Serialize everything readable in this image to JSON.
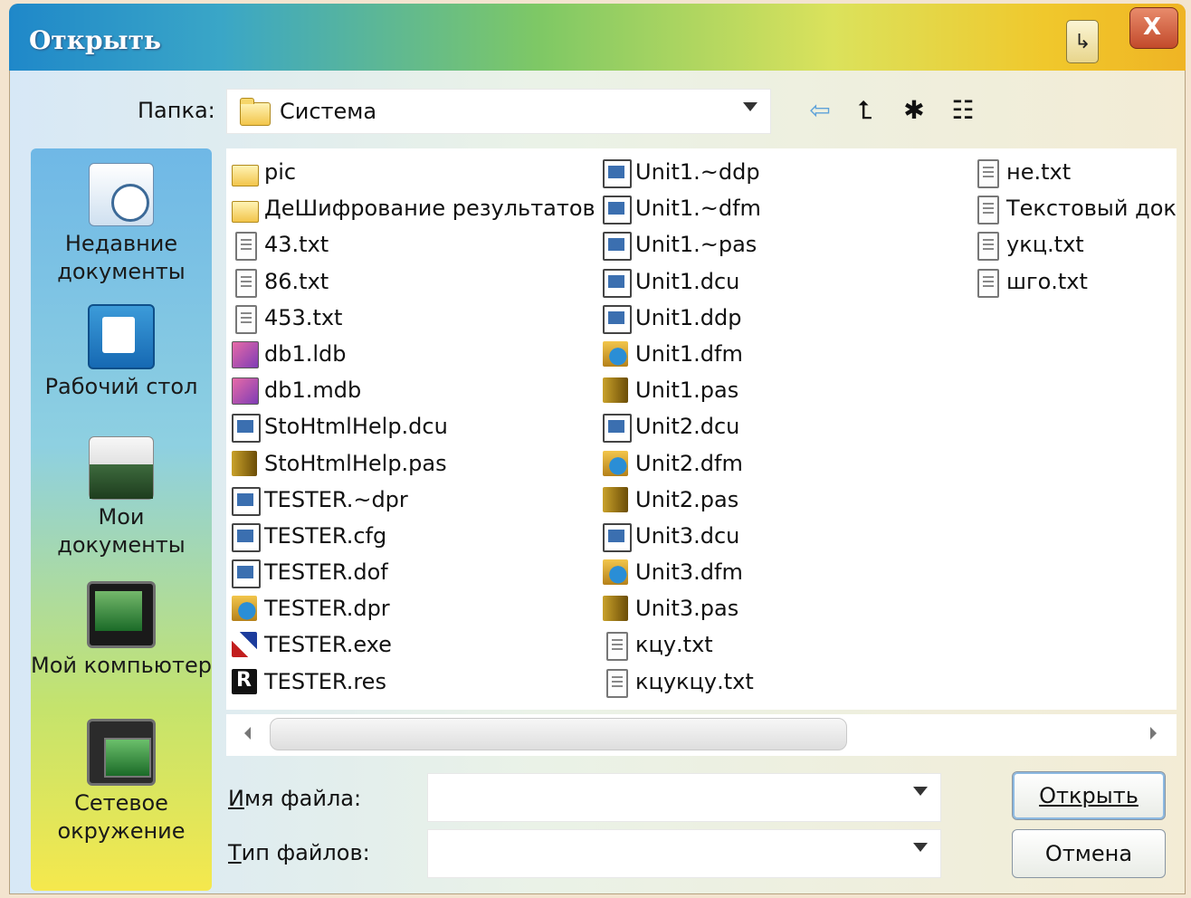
{
  "window": {
    "title": "Открыть"
  },
  "titlebar": {
    "close_label": "X"
  },
  "folder": {
    "label": "Папка:",
    "current": "Система"
  },
  "places": [
    {
      "label": "Недавние документы",
      "icon": "recent-documents-icon"
    },
    {
      "label": "Рабочий стол",
      "icon": "desktop-icon"
    },
    {
      "label": "Мои документы",
      "icon": "my-documents-icon"
    },
    {
      "label": "Мой компьютер",
      "icon": "my-computer-icon"
    },
    {
      "label": "Сетевое окружение",
      "icon": "network-icon"
    }
  ],
  "files": {
    "col1": [
      {
        "name": "pic",
        "icon": "folder-icon"
      },
      {
        "name": "ДеШифрование результатов",
        "icon": "folder-icon"
      },
      {
        "name": "43.txt",
        "icon": "text-file-icon"
      },
      {
        "name": "86.txt",
        "icon": "text-file-icon"
      },
      {
        "name": "453.txt",
        "icon": "text-file-icon"
      },
      {
        "name": "db1.ldb",
        "icon": "database-file-icon"
      },
      {
        "name": "db1.mdb",
        "icon": "database-file-icon"
      },
      {
        "name": "StoHtmlHelp.dcu",
        "icon": "delphi-unit-icon"
      },
      {
        "name": "StoHtmlHelp.pas",
        "icon": "pascal-source-icon"
      },
      {
        "name": "TESTER.~dpr",
        "icon": "delphi-unit-icon"
      },
      {
        "name": "TESTER.cfg",
        "icon": "delphi-unit-icon"
      },
      {
        "name": "TESTER.dof",
        "icon": "delphi-unit-icon"
      },
      {
        "name": "TESTER.dpr",
        "icon": "delphi-project-icon"
      },
      {
        "name": "TESTER.exe",
        "icon": "exe-icon"
      },
      {
        "name": "TESTER.res",
        "icon": "resource-file-icon"
      }
    ],
    "col2": [
      {
        "name": "Unit1.~ddp",
        "icon": "delphi-unit-icon"
      },
      {
        "name": "Unit1.~dfm",
        "icon": "delphi-unit-icon"
      },
      {
        "name": "Unit1.~pas",
        "icon": "delphi-unit-icon"
      },
      {
        "name": "Unit1.dcu",
        "icon": "delphi-unit-icon"
      },
      {
        "name": "Unit1.ddp",
        "icon": "delphi-unit-icon"
      },
      {
        "name": "Unit1.dfm",
        "icon": "delphi-project-icon"
      },
      {
        "name": "Unit1.pas",
        "icon": "pascal-source-icon"
      },
      {
        "name": "Unit2.dcu",
        "icon": "delphi-unit-icon"
      },
      {
        "name": "Unit2.dfm",
        "icon": "delphi-project-icon"
      },
      {
        "name": "Unit2.pas",
        "icon": "pascal-source-icon"
      },
      {
        "name": "Unit3.dcu",
        "icon": "delphi-unit-icon"
      },
      {
        "name": "Unit3.dfm",
        "icon": "delphi-project-icon"
      },
      {
        "name": "Unit3.pas",
        "icon": "pascal-source-icon"
      },
      {
        "name": "кцу.txt",
        "icon": "text-file-icon"
      },
      {
        "name": "кцукцу.txt",
        "icon": "text-file-icon"
      }
    ],
    "col3": [
      {
        "name": "не.txt",
        "icon": "text-file-icon"
      },
      {
        "name": "Текстовый док",
        "icon": "text-file-icon"
      },
      {
        "name": "укц.txt",
        "icon": "text-file-icon"
      },
      {
        "name": "шго.txt",
        "icon": "text-file-icon"
      }
    ]
  },
  "filename": {
    "label": "Имя файла:",
    "value": ""
  },
  "filetype": {
    "label": "Тип файлов:",
    "value": ""
  },
  "buttons": {
    "open": "Открыть",
    "cancel": "Отмена"
  }
}
